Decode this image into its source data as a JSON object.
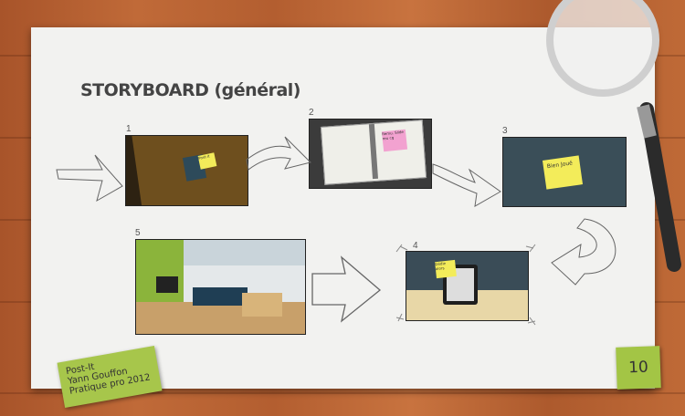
{
  "slide": {
    "title": "STORYBOARD (général)",
    "page_number": "10"
  },
  "frames": [
    {
      "number": "1",
      "note": "Post-it"
    },
    {
      "number": "2",
      "note": "Remu. Slide reu cg"
    },
    {
      "number": "3",
      "note": "Bien Joué"
    },
    {
      "number": "4",
      "note": "Dédie alors"
    },
    {
      "number": "5",
      "note": ""
    }
  ],
  "footer_note": {
    "line1": "Post-It",
    "line2": "Yann Gouffon",
    "line3": "Pratique pro 2012"
  },
  "colors": {
    "paper": "#f2f2f0",
    "sticky_yellow": "#f3ec5a",
    "sticky_green": "#a7c64b"
  }
}
